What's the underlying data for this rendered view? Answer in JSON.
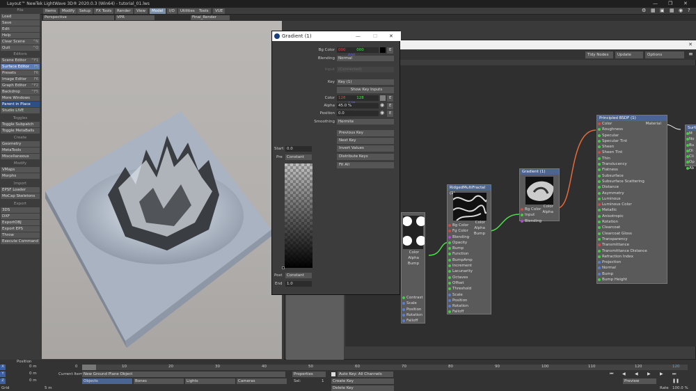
{
  "window": {
    "title": "Layout™ NewTek LightWave 3D® 2020.0.3 (Win64) - tutorial_01.lws"
  },
  "menu_tabs": [
    "Items",
    "Modify",
    "Setup",
    "FX Tools",
    "Render",
    "View",
    "Model",
    "I/O",
    "Utilities",
    "Tools",
    "VUE"
  ],
  "active_tab": "Model",
  "viewport_bar": {
    "view": "Perspective",
    "vpr": "VPR",
    "camera": "Final_Render"
  },
  "left_panel": {
    "file_header": "File",
    "file_items": [
      "Load",
      "Save",
      "Edit",
      "Help"
    ],
    "clear_scene": "Clear Scene",
    "clear_key": "^N",
    "quit": "Quit",
    "quit_key": "^Q",
    "editors_header": "Editors",
    "editors": [
      [
        "Scene Editor",
        "^F1"
      ],
      [
        "Surface Editor",
        "F5"
      ],
      [
        "Presets",
        "F6"
      ],
      [
        "Image Editor",
        "F6"
      ],
      [
        "Graph Editor",
        "^F2"
      ],
      [
        "Backdrop",
        "^F5"
      ]
    ],
    "more_windows": "More Windows",
    "parent_in_place": "Parent in Place",
    "studio_live": "Studio LIVE",
    "toggles_header": "Toggles",
    "toggles": [
      "Toggle Subpatch",
      "Toggle MetaBalls"
    ],
    "create_header": "Create",
    "create": [
      "Geometry",
      "MetaTools",
      "Miscellaneous"
    ],
    "modify_header": "Modify",
    "modify": [
      "VMaps",
      "Morphs"
    ],
    "import_header": "Import",
    "imports": [
      "EPSF Loader",
      "MoCap Skeletons"
    ],
    "export_header": "Export",
    "exports": [
      "3DS",
      "DXF",
      "ExportOBJ",
      "Export EPS",
      "Throw"
    ],
    "execute": "Execute Command"
  },
  "node_editor": {
    "buttons": [
      "Tidy Nodes",
      "Update",
      "Options"
    ],
    "principled": {
      "title": "Principled BSDF (1)",
      "out": "Material",
      "inputs": [
        "Color",
        "Roughness",
        "Specular",
        "Specular Tint",
        "Sheen",
        "Sheen Tint",
        "Thin",
        "Translucency",
        "Flatness",
        "Subsurface",
        "Subsurface Scattering",
        "Distance",
        "Asymmetry",
        "Luminous",
        "Luminous Color",
        "Metallic",
        "Anisotropic",
        "Rotation",
        "Clearcoat",
        "Clearcoat Gloss",
        "Transparency",
        "Transmittance",
        "Transmittance Distance",
        "Refraction Index",
        "Projection",
        "Normal",
        "Bump",
        "Bump Height"
      ]
    },
    "gradient_node": {
      "title": "Gradient (1)",
      "inputs": [
        "Bg Color",
        "Input",
        "Blending"
      ],
      "outputs": [
        "Color",
        "Alpha"
      ]
    },
    "ridged": {
      "title": "RidgedMultiFractal (1)",
      "inputs": [
        "Bg Color",
        "Fg Color",
        "Blending",
        "Opacity",
        "Bump",
        "Function",
        "BumpAmp",
        "Increment",
        "Lacunarity",
        "Octaves",
        "Offset",
        "Threshold",
        "Scale",
        "Position",
        "Rotation",
        "Falloff"
      ],
      "outputs": [
        "Color",
        "Alpha",
        "Bump"
      ]
    },
    "third": {
      "outputs": [
        "Color",
        "Alpha",
        "Bump"
      ],
      "inputs": [
        "Contrast",
        "Scale",
        "Position",
        "Rotation",
        "Falloff"
      ]
    },
    "surface_partial": {
      "title": "Surfa",
      "items": [
        "M",
        "No",
        "Bu",
        "Di",
        "Cli",
        "Op",
        "Ab"
      ]
    }
  },
  "gradient_dialog": {
    "title": "Gradient (1)",
    "bg_color_label": "Bg Color",
    "bg_r": "000",
    "bg_g": "000",
    "bg_b": "000",
    "blending_label": "Blending",
    "blending": "Normal",
    "input_label": "Input",
    "input_value": "(Connected)",
    "key_label": "Key",
    "key": "Key (1)",
    "show_key_inputs": "Show Key Inputs",
    "color_label": "Color",
    "r": "128",
    "g": "128",
    "b": "128",
    "alpha_label": "Alpha",
    "alpha": "45.0 %",
    "position_label": "Position",
    "position": "0.0",
    "smoothing_label": "Smoothing",
    "smoothing": "Hermite",
    "start_label": "Start",
    "start": "0.0",
    "pre_label": "Pre",
    "pre": "Constant",
    "post_label": "Post",
    "post": "Constant",
    "end_label": "End",
    "end": "1.0",
    "buttons": [
      "Previous Key",
      "Next Key",
      "Invert Values",
      "Distribute Keys",
      "Fit All"
    ],
    "e": "E"
  },
  "timeline": {
    "position_label": "Position",
    "ticks": [
      "0",
      "10",
      "20",
      "30",
      "40",
      "50",
      "60",
      "70",
      "80",
      "90",
      "100",
      "110",
      "120"
    ],
    "end_frame": "120",
    "axes": [
      [
        "X",
        "0 m"
      ],
      [
        "Y",
        "0 m"
      ],
      [
        "Z",
        "0 m"
      ]
    ],
    "grid_label": "Grid",
    "grid": "5 m",
    "current_item_label": "Current Item",
    "current_item": "New Ground Plane Object",
    "modes": [
      "Objects",
      "Bones",
      "Lights",
      "Cameras"
    ],
    "properties": "Properties",
    "sel_label": "Sel:",
    "sel": "1",
    "autokey": "Auto Key: All Channels",
    "create_key": "Create Key",
    "delete_key": "Delete Key",
    "preview": "Preview",
    "rate_label": "Rate",
    "rate": "100.0 %"
  }
}
